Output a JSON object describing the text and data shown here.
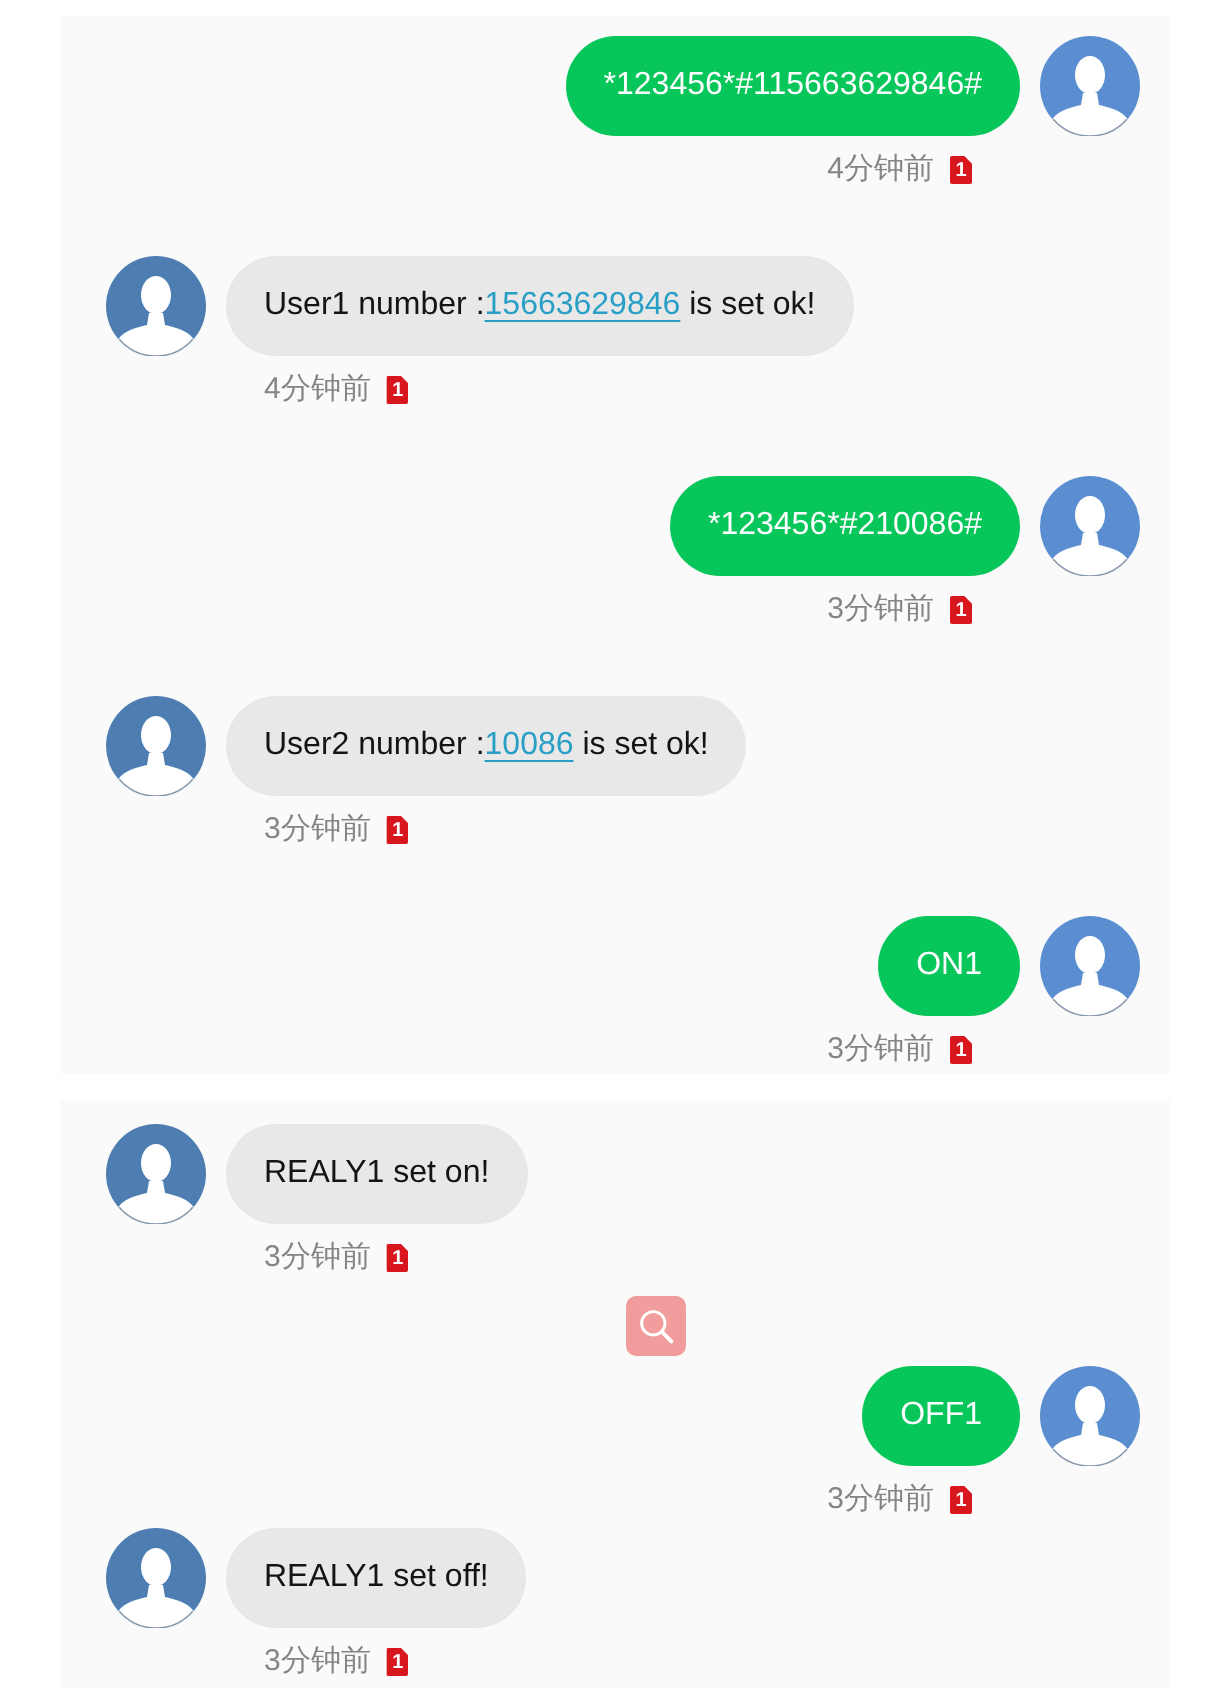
{
  "panels": [
    {
      "items": [
        {
          "kind": "outgoing",
          "parts": [
            {
              "kind": "text",
              "text": "*123456*#115663629846#"
            }
          ],
          "time": "4分钟前",
          "sim": "1"
        },
        {
          "kind": "incoming",
          "parts": [
            {
              "kind": "text",
              "text": "User1 number :"
            },
            {
              "kind": "link",
              "text": "15663629846"
            },
            {
              "kind": "text",
              "text": " is set ok!"
            }
          ],
          "time": "4分钟前",
          "sim": "1"
        },
        {
          "kind": "outgoing",
          "parts": [
            {
              "kind": "text",
              "text": "*123456*#210086#"
            }
          ],
          "time": "3分钟前",
          "sim": "1"
        },
        {
          "kind": "incoming",
          "parts": [
            {
              "kind": "text",
              "text": "User2 number :"
            },
            {
              "kind": "link",
              "text": "10086"
            },
            {
              "kind": "text",
              "text": " is set ok!"
            }
          ],
          "time": "3分钟前",
          "sim": "1"
        },
        {
          "kind": "outgoing",
          "parts": [
            {
              "kind": "text",
              "text": "ON1"
            }
          ],
          "time": "3分钟前",
          "sim": "1"
        }
      ]
    },
    {
      "items": [
        {
          "kind": "incoming",
          "parts": [
            {
              "kind": "text",
              "text": "REALY1 set on!"
            }
          ],
          "time": "3分钟前",
          "sim": "1"
        },
        {
          "kind": "search"
        },
        {
          "kind": "outgoing",
          "parts": [
            {
              "kind": "text",
              "text": "OFF1"
            }
          ],
          "time": "3分钟前",
          "sim": "1"
        },
        {
          "kind": "incoming",
          "parts": [
            {
              "kind": "text",
              "text": "REALY1 set off!"
            }
          ],
          "time": "3分钟前",
          "sim": "1"
        }
      ]
    }
  ]
}
